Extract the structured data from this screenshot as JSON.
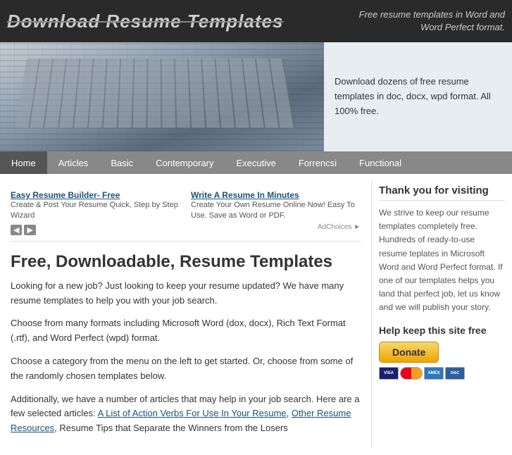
{
  "header": {
    "title": "Download Resume Templates",
    "tagline": "Free resume templates in Word and Word Perfect format."
  },
  "hero": {
    "text": "Download dozens of free resume templates in doc, docx, wpd format. All 100% free."
  },
  "nav": {
    "items": [
      {
        "label": "Home",
        "active": true
      },
      {
        "label": "Articles",
        "active": false
      },
      {
        "label": "Basic",
        "active": false
      },
      {
        "label": "Contemporary",
        "active": false
      },
      {
        "label": "Executive",
        "active": false
      },
      {
        "label": "Forrencsi",
        "active": false
      },
      {
        "label": "Functional",
        "active": false
      }
    ]
  },
  "ads": [
    {
      "title": "Easy Resume Builder- Free",
      "description": "Create & Post Your Resume Quick, Step by Step Wizard"
    },
    {
      "title": "Write A Resume In Minutes",
      "description": "Create Your Own Resume Online Now! Easy To Use. Save as Word or PDF."
    }
  ],
  "main": {
    "heading": "Free, Downloadable, Resume Templates",
    "paragraphs": [
      "Looking for a new job? Just looking to keep your resume updated? We have many resume templates to help you with your job search.",
      "Choose from many formats including Microsoft Word (dox, docx), Rich Text Format (.rtf), and Word Perfect (wpd) format.",
      "Choose a category from the menu on the left to get started. Or, choose from some of the randomly chosen templates below.",
      "Additionally, we have a number of articles that may help in your job search. Here are a few selected articles: A List of Action Verbs For Use In Your Resume, Other Resume Resources, Resume Tips that Separate the Winners from the Losers"
    ],
    "links": {
      "action_verbs": "A List of Action Verbs For Use In Your Resume",
      "other_resume": "Other Resume Resources",
      "resume_tips": "Resume Tips that Separate the Winners from the Losers"
    }
  },
  "sidebar": {
    "thank_you_title": "Thank you for visiting",
    "thank_you_text": "We strive to keep our resume templates completely free. Hundreds of ready-to-use resume teplates in Microsoft Word and Word Perfect format. If one of our templates helps you land that perfect job, let us know and we will publish your story.",
    "help_title": "Help keep this site free",
    "donate_label": "Donate"
  }
}
